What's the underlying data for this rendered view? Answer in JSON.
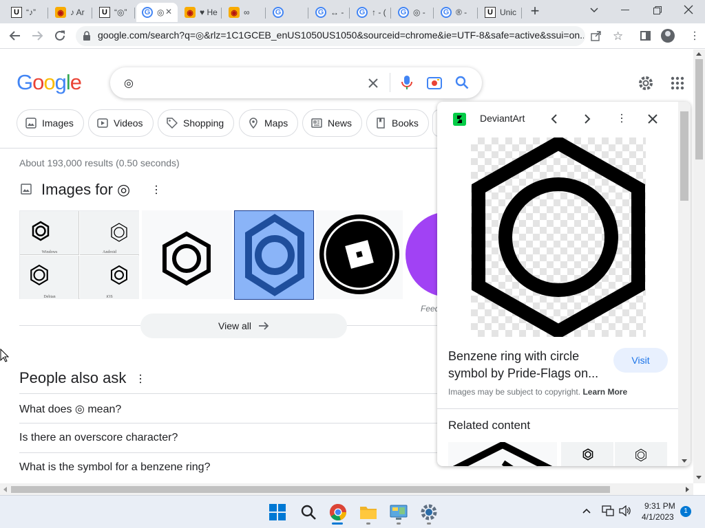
{
  "browser": {
    "tabs": [
      {
        "title": "“♪”",
        "favicon": "unicode-icon"
      },
      {
        "title": "♪ Ar",
        "favicon": "fire-icon"
      },
      {
        "title": "“◎”",
        "favicon": "unicode-icon"
      },
      {
        "title": "◎",
        "favicon": "google-icon",
        "active": true
      },
      {
        "title": "♥ He",
        "favicon": "fire-icon"
      },
      {
        "title": "∞",
        "favicon": "fire-icon"
      },
      {
        "title": "",
        "favicon": "google-icon"
      },
      {
        "title": "↔ -",
        "favicon": "google-icon"
      },
      {
        "title": "↑ - (",
        "favicon": "google-icon"
      },
      {
        "title": "◎ -",
        "favicon": "google-icon"
      },
      {
        "title": "® -",
        "favicon": "google-icon"
      },
      {
        "title": "Unic",
        "favicon": "unicode-icon"
      }
    ],
    "url": "google.com/search?q=◎&rlz=1C1GCEB_enUS1050US1050&sourceid=chrome&ie=UTF-8&safe=active&ssui=on..."
  },
  "google": {
    "logo": "Google",
    "query": "◎",
    "chips": [
      "Images",
      "Videos",
      "Shopping",
      "Maps",
      "News",
      "Books"
    ],
    "result_stats": "About 193,000 results (0.50 seconds)",
    "images_heading": "Images for ◎",
    "thumb_labels": [
      "Windows",
      "Android",
      "Debian",
      "iOS"
    ],
    "feedback": "Feed",
    "view_all": "View all",
    "paa_heading": "People also ask",
    "paa_questions": [
      "What does ◎ mean?",
      "Is there an overscore character?",
      "What is the symbol for a benzene ring?"
    ]
  },
  "panel": {
    "source": "DeviantArt",
    "title": "Benzene ring with circle symbol by Pride-Flags on...",
    "visit": "Visit",
    "copyright": "Images may be subject to copyright.",
    "learn_more": "Learn More",
    "related": "Related content"
  },
  "taskbar": {
    "time": "9:31 PM",
    "date": "4/1/2023",
    "notifications": "1"
  },
  "colors": {
    "accent_blue": "#1a73e8",
    "selected_thumb": "#8ab4f8",
    "tabstrip": "#dee1e6"
  }
}
